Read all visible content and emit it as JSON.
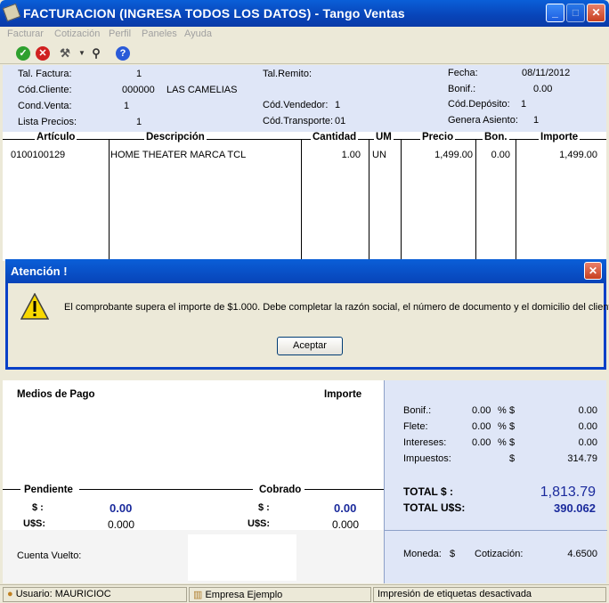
{
  "window": {
    "title": "FACTURACION (INGRESA TODOS LOS DATOS) - Tango Ventas"
  },
  "menu": [
    "Facturar",
    "Cotización",
    "Perfil",
    "Paneles",
    "Ayuda"
  ],
  "header": {
    "tal_factura_label": "Tal. Factura:",
    "tal_factura": "1",
    "cod_cliente_label": "Cód.Cliente:",
    "cod_cliente": "000000",
    "cliente_nombre": "LAS CAMELIAS",
    "cond_venta_label": "Cond.Venta:",
    "cond_venta": "1",
    "lista_precios_label": "Lista Precios:",
    "lista_precios": "1",
    "tal_remito_label": "Tal.Remito:",
    "cod_vendedor_label": "Cód.Vendedor:",
    "cod_vendedor": "1",
    "cod_transporte_label": "Cód.Transporte:",
    "cod_transporte": "01",
    "fecha_label": "Fecha:",
    "fecha": "08/11/2012",
    "bonif_label": "Bonif.:",
    "bonif": "0.00",
    "cod_deposito_label": "Cód.Depósito:",
    "cod_deposito": "1",
    "genera_asiento_label": "Genera Asiento:",
    "genera_asiento": "1"
  },
  "grid": {
    "headers": {
      "articulo": "Artículo",
      "descripcion": "Descripción",
      "cantidad": "Cantidad",
      "um": "UM",
      "precio": "Precio",
      "bon": "Bon.",
      "importe": "Importe"
    },
    "row": {
      "articulo": "0100100129",
      "descripcion": "HOME THEATER MARCA TCL",
      "cantidad": "1.00",
      "um": "UN",
      "precio": "1,499.00",
      "bon": "0.00",
      "importe": "1,499.00"
    }
  },
  "dialog": {
    "title": "Atención !",
    "message": "El comprobante supera el importe de $1.000. Debe completar la razón social, el número de documento y el domicilio del cliente",
    "button": "Aceptar"
  },
  "payment": {
    "medios_label": "Medios de Pago",
    "importe_label": "Importe",
    "pendiente_label": "Pendiente",
    "cobrado_label": "Cobrado",
    "peso_label": "$ :",
    "usd_label": "U$S:",
    "pendiente_peso": "0.00",
    "pendiente_usd": "0.000",
    "cobrado_peso": "0.00",
    "cobrado_usd": "0.000",
    "cuenta_vuelto_label": "Cuenta Vuelto:"
  },
  "totals": {
    "bonif_label": "Bonif.:",
    "bonif_pct": "0.00",
    "bonif_amt": "0.00",
    "flete_label": "Flete:",
    "flete_pct": "0.00",
    "flete_amt": "0.00",
    "intereses_label": "Intereses:",
    "intereses_pct": "0.00",
    "intereses_amt": "0.00",
    "impuestos_label": "Impuestos:",
    "impuestos_amt": "314.79",
    "pct": "%",
    "cur": "$",
    "total_label": "TOTAL  $ :",
    "total": "1,813.79",
    "total_usd_label": "TOTAL U$S:",
    "total_usd": "390.062",
    "moneda_label": "Moneda:",
    "moneda": "$",
    "cotizacion_label": "Cotización:",
    "cotizacion": "4.6500"
  },
  "status": {
    "usuario": "Usuario: MAURICIOC",
    "empresa": "Empresa Ejemplo",
    "impresion": "Impresión de etiquetas desactivada"
  },
  "colors": {
    "titlebar": "#0844b8",
    "panel": "#dfe6f7",
    "total_blue": "#1a2a9c"
  },
  "icons": [
    "check-icon",
    "cancel-icon",
    "tools-icon",
    "search-icon",
    "help-icon",
    "warning-icon",
    "user-icon",
    "building-icon"
  ]
}
